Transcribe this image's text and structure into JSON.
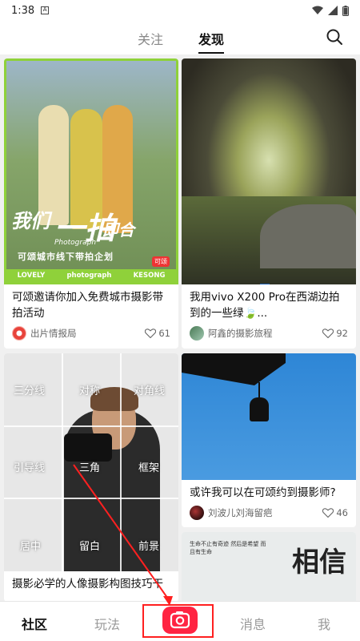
{
  "status_bar": {
    "time": "1:38",
    "sim_glyph": "A"
  },
  "top_nav": {
    "tabs": [
      {
        "label": "关注"
      },
      {
        "label": "发现",
        "active": true
      }
    ]
  },
  "feed": {
    "cards": [
      {
        "title": "可颂邀请你加入免费城市摄影带拍活动",
        "author": "出片情报局",
        "likes": "61",
        "image": {
          "headline_1": "我们",
          "headline_2": "一拍",
          "headline_3": "即合",
          "headline_script": "Photograph",
          "subline": "可颂城市线下带拍企划",
          "brand": "可颂",
          "strip": [
            "LOVELY",
            "photograph",
            "KESONG"
          ]
        }
      },
      {
        "title": "我用vivo X200 Pro在西湖边拍到的一些绿",
        "emoji": "🍃",
        "suffix": "...",
        "author": "阿鑫的摄影旅程",
        "likes": "92"
      },
      {
        "title": "摄影必学的人像摄影构图技巧干",
        "image": {
          "grid_labels": [
            "三分线",
            "对称",
            "对角线",
            "引导线",
            "三角",
            "框架",
            "居中",
            "留白",
            "前景"
          ]
        }
      },
      {
        "title": "或许我可以在可颂约到摄影师?",
        "author": "刘波儿刘海留疤",
        "likes": "46"
      },
      {
        "image": {
          "big_text": "相信",
          "small_text": "生命不止有奇迹 然后是希望 而且有生命"
        }
      }
    ]
  },
  "bottom_nav": {
    "items": [
      {
        "label": "社区",
        "active": true
      },
      {
        "label": "玩法"
      },
      {
        "label": "消息"
      },
      {
        "label": "我"
      }
    ]
  },
  "colors": {
    "brand_red": "#ff2442",
    "annotation_red": "#ff2020",
    "poster_green": "#8fd13a"
  },
  "icons": [
    "sim-icon",
    "wifi-icon",
    "signal-icon",
    "battery-icon",
    "search-icon",
    "heart-icon",
    "camera-icon"
  ]
}
